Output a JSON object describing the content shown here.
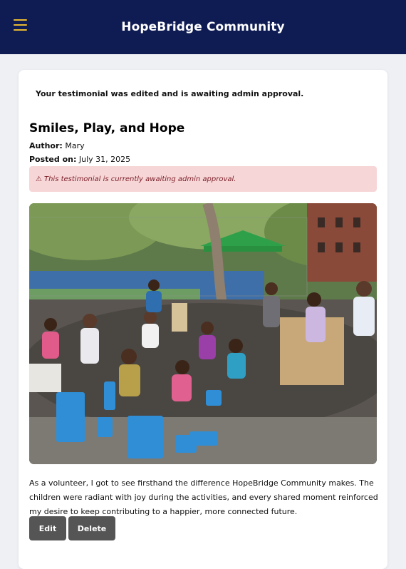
{
  "header": {
    "menu_icon": "hamburger-menu-icon",
    "brand": "HopeBridge Community"
  },
  "flash": {
    "message": "Your testimonial was edited and is awaiting admin approval."
  },
  "testimonial": {
    "title": "Smiles, Play, and Hope",
    "author_label": "Author:",
    "author": "Mary",
    "posted_label": "Posted on:",
    "posted_date": "July 31, 2025",
    "pending_icon": "warning-triangle-icon",
    "pending_message": "This testimonial is currently awaiting admin approval.",
    "body": "As a volunteer, I got to see firsthand the difference HopeBridge Community makes. The children were radiant with joy during the activities, and every shared moment reinforced my desire to keep contributing to a happier, more connected future.",
    "actions": {
      "edit_label": "Edit",
      "delete_label": "Delete"
    }
  },
  "colors": {
    "header_bg": "#0f1c54",
    "menu_icon": "#e8b931",
    "pending_bg": "#f7d6d8",
    "pending_text": "#7a1f27",
    "button_bg": "#555555"
  }
}
